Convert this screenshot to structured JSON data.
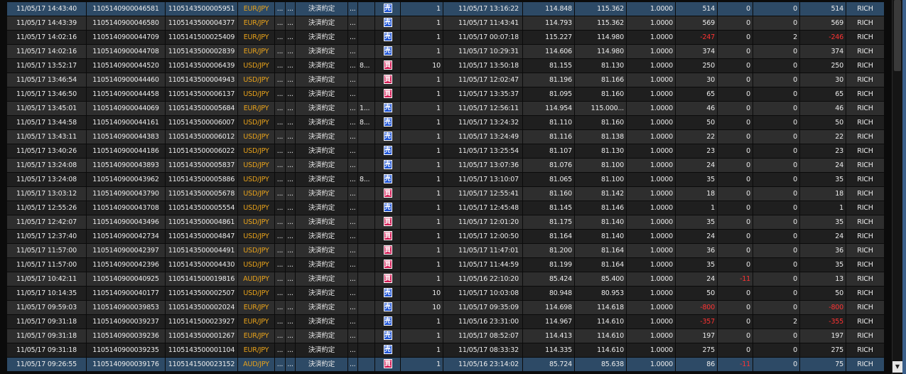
{
  "colors": {
    "background": "#0b0b0b",
    "row_dark": "#1f1f1f",
    "row_light": "#2e2e2e",
    "row_selected": "#2d4a66",
    "pair_text": "#e8a21a",
    "negative": "#ff3333",
    "sell_badge": "#1f55d6",
    "buy_badge": "#d21c55"
  },
  "icons": {
    "scroll_down": "▼"
  },
  "rows": [
    {
      "time": "11/05/17 14:43:40",
      "order_no": "1105140900046581",
      "position_no": "1105143500005951",
      "pair": "EUR/JPY",
      "d1": "...",
      "d2": "...",
      "kind": "決済約定",
      "d3": "...",
      "d4": "",
      "side": "売",
      "side_type": "sell",
      "qty": "1",
      "open_time": "11/05/17 13:16:22",
      "open_price": "114.848",
      "close_price": "115.362",
      "lot": "1.0000",
      "pl": "514",
      "swap": "0",
      "fee": "0",
      "total": "514",
      "user": "RICH",
      "pl_neg": false,
      "swap_neg": false,
      "total_neg": false,
      "selected": true
    },
    {
      "time": "11/05/17 14:43:39",
      "order_no": "1105140900046580",
      "position_no": "1105143500004377",
      "pair": "EUR/JPY",
      "d1": "...",
      "d2": "...",
      "kind": "決済約定",
      "d3": "...",
      "d4": "",
      "side": "売",
      "side_type": "sell",
      "qty": "1",
      "open_time": "11/05/17 11:43:41",
      "open_price": "114.793",
      "close_price": "115.362",
      "lot": "1.0000",
      "pl": "569",
      "swap": "0",
      "fee": "0",
      "total": "569",
      "user": "RICH",
      "pl_neg": false,
      "swap_neg": false,
      "total_neg": false,
      "selected": false
    },
    {
      "time": "11/05/17 14:02:16",
      "order_no": "1105140900044709",
      "position_no": "1105141500025409",
      "pair": "EUR/JPY",
      "d1": "...",
      "d2": "...",
      "kind": "決済約定",
      "d3": "...",
      "d4": "",
      "side": "売",
      "side_type": "sell",
      "qty": "1",
      "open_time": "11/05/17 00:07:18",
      "open_price": "115.227",
      "close_price": "114.980",
      "lot": "1.0000",
      "pl": "-247",
      "swap": "0",
      "fee": "2",
      "total": "-246",
      "user": "RICH",
      "pl_neg": true,
      "swap_neg": false,
      "total_neg": true,
      "selected": false
    },
    {
      "time": "11/05/17 14:02:16",
      "order_no": "1105140900044708",
      "position_no": "1105143500002839",
      "pair": "EUR/JPY",
      "d1": "...",
      "d2": "...",
      "kind": "決済約定",
      "d3": "...",
      "d4": "",
      "side": "売",
      "side_type": "sell",
      "qty": "1",
      "open_time": "11/05/17 10:29:31",
      "open_price": "114.606",
      "close_price": "114.980",
      "lot": "1.0000",
      "pl": "374",
      "swap": "0",
      "fee": "0",
      "total": "374",
      "user": "RICH",
      "pl_neg": false,
      "swap_neg": false,
      "total_neg": false,
      "selected": false
    },
    {
      "time": "11/05/17 13:52:17",
      "order_no": "1105140900044520",
      "position_no": "1105143500006439",
      "pair": "USD/JPY",
      "d1": "...",
      "d2": "...",
      "kind": "決済約定",
      "d3": "...",
      "d4": "8...",
      "side": "買",
      "side_type": "buy",
      "qty": "10",
      "open_time": "11/05/17 13:50:18",
      "open_price": "81.155",
      "close_price": "81.130",
      "lot": "1.0000",
      "pl": "250",
      "swap": "0",
      "fee": "0",
      "total": "250",
      "user": "RICH",
      "pl_neg": false,
      "swap_neg": false,
      "total_neg": false,
      "selected": false
    },
    {
      "time": "11/05/17 13:46:54",
      "order_no": "1105140900044460",
      "position_no": "1105143500004943",
      "pair": "USD/JPY",
      "d1": "...",
      "d2": "...",
      "kind": "決済約定",
      "d3": "...",
      "d4": "",
      "side": "買",
      "side_type": "buy",
      "qty": "1",
      "open_time": "11/05/17 12:02:47",
      "open_price": "81.196",
      "close_price": "81.166",
      "lot": "1.0000",
      "pl": "30",
      "swap": "0",
      "fee": "0",
      "total": "30",
      "user": "RICH",
      "pl_neg": false,
      "swap_neg": false,
      "total_neg": false,
      "selected": false
    },
    {
      "time": "11/05/17 13:46:50",
      "order_no": "1105140900044458",
      "position_no": "1105143500006137",
      "pair": "USD/JPY",
      "d1": "...",
      "d2": "...",
      "kind": "決済約定",
      "d3": "...",
      "d4": "",
      "side": "買",
      "side_type": "buy",
      "qty": "1",
      "open_time": "11/05/17 13:35:37",
      "open_price": "81.095",
      "close_price": "81.160",
      "lot": "1.0000",
      "pl": "65",
      "swap": "0",
      "fee": "0",
      "total": "65",
      "user": "RICH",
      "pl_neg": false,
      "swap_neg": false,
      "total_neg": false,
      "selected": false
    },
    {
      "time": "11/05/17 13:45:01",
      "order_no": "1105140900044069",
      "position_no": "1105143500005684",
      "pair": "EUR/JPY",
      "d1": "...",
      "d2": "...",
      "kind": "決済約定",
      "d3": "...",
      "d4": "1...",
      "side": "売",
      "side_type": "sell",
      "qty": "1",
      "open_time": "11/05/17 12:56:11",
      "open_price": "114.954",
      "close_price": "115.000...",
      "lot": "1.0000",
      "pl": "46",
      "swap": "0",
      "fee": "0",
      "total": "46",
      "user": "RICH",
      "pl_neg": false,
      "swap_neg": false,
      "total_neg": false,
      "selected": false
    },
    {
      "time": "11/05/17 13:44:58",
      "order_no": "1105140900044161",
      "position_no": "1105143500006007",
      "pair": "USD/JPY",
      "d1": "...",
      "d2": "...",
      "kind": "決済約定",
      "d3": "...",
      "d4": "8...",
      "side": "売",
      "side_type": "sell",
      "qty": "1",
      "open_time": "11/05/17 13:24:32",
      "open_price": "81.110",
      "close_price": "81.160",
      "lot": "1.0000",
      "pl": "50",
      "swap": "0",
      "fee": "0",
      "total": "50",
      "user": "RICH",
      "pl_neg": false,
      "swap_neg": false,
      "total_neg": false,
      "selected": false
    },
    {
      "time": "11/05/17 13:43:11",
      "order_no": "1105140900044383",
      "position_no": "1105143500006012",
      "pair": "USD/JPY",
      "d1": "...",
      "d2": "...",
      "kind": "決済約定",
      "d3": "...",
      "d4": "",
      "side": "売",
      "side_type": "sell",
      "qty": "1",
      "open_time": "11/05/17 13:24:49",
      "open_price": "81.116",
      "close_price": "81.138",
      "lot": "1.0000",
      "pl": "22",
      "swap": "0",
      "fee": "0",
      "total": "22",
      "user": "RICH",
      "pl_neg": false,
      "swap_neg": false,
      "total_neg": false,
      "selected": false
    },
    {
      "time": "11/05/17 13:40:26",
      "order_no": "1105140900044186",
      "position_no": "1105143500006022",
      "pair": "USD/JPY",
      "d1": "...",
      "d2": "...",
      "kind": "決済約定",
      "d3": "...",
      "d4": "",
      "side": "売",
      "side_type": "sell",
      "qty": "1",
      "open_time": "11/05/17 13:25:54",
      "open_price": "81.107",
      "close_price": "81.130",
      "lot": "1.0000",
      "pl": "23",
      "swap": "0",
      "fee": "0",
      "total": "23",
      "user": "RICH",
      "pl_neg": false,
      "swap_neg": false,
      "total_neg": false,
      "selected": false
    },
    {
      "time": "11/05/17 13:24:08",
      "order_no": "1105140900043893",
      "position_no": "1105143500005837",
      "pair": "USD/JPY",
      "d1": "...",
      "d2": "...",
      "kind": "決済約定",
      "d3": "...",
      "d4": "",
      "side": "売",
      "side_type": "sell",
      "qty": "1",
      "open_time": "11/05/17 13:07:36",
      "open_price": "81.076",
      "close_price": "81.100",
      "lot": "1.0000",
      "pl": "24",
      "swap": "0",
      "fee": "0",
      "total": "24",
      "user": "RICH",
      "pl_neg": false,
      "swap_neg": false,
      "total_neg": false,
      "selected": false
    },
    {
      "time": "11/05/17 13:24:08",
      "order_no": "1105140900043962",
      "position_no": "1105143500005886",
      "pair": "USD/JPY",
      "d1": "...",
      "d2": "...",
      "kind": "決済約定",
      "d3": "...",
      "d4": "8...",
      "side": "売",
      "side_type": "sell",
      "qty": "1",
      "open_time": "11/05/17 13:10:07",
      "open_price": "81.065",
      "close_price": "81.100",
      "lot": "1.0000",
      "pl": "35",
      "swap": "0",
      "fee": "0",
      "total": "35",
      "user": "RICH",
      "pl_neg": false,
      "swap_neg": false,
      "total_neg": false,
      "selected": false
    },
    {
      "time": "11/05/17 13:03:12",
      "order_no": "1105140900043790",
      "position_no": "1105143500005678",
      "pair": "USD/JPY",
      "d1": "...",
      "d2": "...",
      "kind": "決済約定",
      "d3": "...",
      "d4": "",
      "side": "買",
      "side_type": "buy",
      "qty": "1",
      "open_time": "11/05/17 12:55:41",
      "open_price": "81.160",
      "close_price": "81.142",
      "lot": "1.0000",
      "pl": "18",
      "swap": "0",
      "fee": "0",
      "total": "18",
      "user": "RICH",
      "pl_neg": false,
      "swap_neg": false,
      "total_neg": false,
      "selected": false
    },
    {
      "time": "11/05/17 12:55:26",
      "order_no": "1105140900043708",
      "position_no": "1105143500005554",
      "pair": "USD/JPY",
      "d1": "...",
      "d2": "...",
      "kind": "決済約定",
      "d3": "...",
      "d4": "",
      "side": "売",
      "side_type": "sell",
      "qty": "1",
      "open_time": "11/05/17 12:45:48",
      "open_price": "81.145",
      "close_price": "81.146",
      "lot": "1.0000",
      "pl": "1",
      "swap": "0",
      "fee": "0",
      "total": "1",
      "user": "RICH",
      "pl_neg": false,
      "swap_neg": false,
      "total_neg": false,
      "selected": false
    },
    {
      "time": "11/05/17 12:42:07",
      "order_no": "1105140900043496",
      "position_no": "1105143500004861",
      "pair": "USD/JPY",
      "d1": "...",
      "d2": "...",
      "kind": "決済約定",
      "d3": "...",
      "d4": "",
      "side": "買",
      "side_type": "buy",
      "qty": "1",
      "open_time": "11/05/17 12:01:20",
      "open_price": "81.175",
      "close_price": "81.140",
      "lot": "1.0000",
      "pl": "35",
      "swap": "0",
      "fee": "0",
      "total": "35",
      "user": "RICH",
      "pl_neg": false,
      "swap_neg": false,
      "total_neg": false,
      "selected": false
    },
    {
      "time": "11/05/17 12:37:40",
      "order_no": "1105140900042734",
      "position_no": "1105143500004847",
      "pair": "USD/JPY",
      "d1": "...",
      "d2": "...",
      "kind": "決済約定",
      "d3": "...",
      "d4": "",
      "side": "買",
      "side_type": "buy",
      "qty": "1",
      "open_time": "11/05/17 12:00:50",
      "open_price": "81.164",
      "close_price": "81.140",
      "lot": "1.0000",
      "pl": "24",
      "swap": "0",
      "fee": "0",
      "total": "24",
      "user": "RICH",
      "pl_neg": false,
      "swap_neg": false,
      "total_neg": false,
      "selected": false
    },
    {
      "time": "11/05/17 11:57:00",
      "order_no": "1105140900042397",
      "position_no": "1105143500004491",
      "pair": "USD/JPY",
      "d1": "...",
      "d2": "...",
      "kind": "決済約定",
      "d3": "...",
      "d4": "",
      "side": "買",
      "side_type": "buy",
      "qty": "1",
      "open_time": "11/05/17 11:47:01",
      "open_price": "81.200",
      "close_price": "81.164",
      "lot": "1.0000",
      "pl": "36",
      "swap": "0",
      "fee": "0",
      "total": "36",
      "user": "RICH",
      "pl_neg": false,
      "swap_neg": false,
      "total_neg": false,
      "selected": false
    },
    {
      "time": "11/05/17 11:57:00",
      "order_no": "1105140900042396",
      "position_no": "1105143500004430",
      "pair": "USD/JPY",
      "d1": "...",
      "d2": "...",
      "kind": "決済約定",
      "d3": "...",
      "d4": "",
      "side": "買",
      "side_type": "buy",
      "qty": "1",
      "open_time": "11/05/17 11:44:59",
      "open_price": "81.199",
      "close_price": "81.164",
      "lot": "1.0000",
      "pl": "35",
      "swap": "0",
      "fee": "0",
      "total": "35",
      "user": "RICH",
      "pl_neg": false,
      "swap_neg": false,
      "total_neg": false,
      "selected": false
    },
    {
      "time": "11/05/17 10:42:11",
      "order_no": "1105140900040925",
      "position_no": "1105141500019816",
      "pair": "AUD/JPY",
      "d1": "...",
      "d2": "...",
      "kind": "決済約定",
      "d3": "...",
      "d4": "",
      "side": "買",
      "side_type": "buy",
      "qty": "1",
      "open_time": "11/05/16 22:10:20",
      "open_price": "85.424",
      "close_price": "85.400",
      "lot": "1.0000",
      "pl": "24",
      "swap": "-11",
      "fee": "0",
      "total": "13",
      "user": "RICH",
      "pl_neg": false,
      "swap_neg": true,
      "total_neg": false,
      "selected": false
    },
    {
      "time": "11/05/17 10:14:35",
      "order_no": "1105140900040177",
      "position_no": "1105143500002507",
      "pair": "USD/JPY",
      "d1": "...",
      "d2": "...",
      "kind": "決済約定",
      "d3": "...",
      "d4": "",
      "side": "売",
      "side_type": "sell",
      "qty": "10",
      "open_time": "11/05/17 10:03:08",
      "open_price": "80.948",
      "close_price": "80.953",
      "lot": "1.0000",
      "pl": "50",
      "swap": "0",
      "fee": "0",
      "total": "50",
      "user": "RICH",
      "pl_neg": false,
      "swap_neg": false,
      "total_neg": false,
      "selected": false
    },
    {
      "time": "11/05/17 09:59:03",
      "order_no": "1105140900039853",
      "position_no": "1105143500002024",
      "pair": "EUR/JPY",
      "d1": "...",
      "d2": "...",
      "kind": "決済約定",
      "d3": "...",
      "d4": "",
      "side": "売",
      "side_type": "sell",
      "qty": "10",
      "open_time": "11/05/17 09:35:09",
      "open_price": "114.698",
      "close_price": "114.618",
      "lot": "1.0000",
      "pl": "-800",
      "swap": "0",
      "fee": "0",
      "total": "-800",
      "user": "RICH",
      "pl_neg": true,
      "swap_neg": false,
      "total_neg": true,
      "selected": false
    },
    {
      "time": "11/05/17 09:31:18",
      "order_no": "1105140900039237",
      "position_no": "1105141500023927",
      "pair": "EUR/JPY",
      "d1": "...",
      "d2": "...",
      "kind": "決済約定",
      "d3": "...",
      "d4": "",
      "side": "売",
      "side_type": "sell",
      "qty": "1",
      "open_time": "11/05/16 23:31:00",
      "open_price": "114.967",
      "close_price": "114.610",
      "lot": "1.0000",
      "pl": "-357",
      "swap": "0",
      "fee": "2",
      "total": "-355",
      "user": "RICH",
      "pl_neg": true,
      "swap_neg": false,
      "total_neg": true,
      "selected": false
    },
    {
      "time": "11/05/17 09:31:18",
      "order_no": "1105140900039236",
      "position_no": "1105143500001267",
      "pair": "EUR/JPY",
      "d1": "...",
      "d2": "...",
      "kind": "決済約定",
      "d3": "...",
      "d4": "",
      "side": "売",
      "side_type": "sell",
      "qty": "1",
      "open_time": "11/05/17 08:52:07",
      "open_price": "114.413",
      "close_price": "114.610",
      "lot": "1.0000",
      "pl": "197",
      "swap": "0",
      "fee": "0",
      "total": "197",
      "user": "RICH",
      "pl_neg": false,
      "swap_neg": false,
      "total_neg": false,
      "selected": false
    },
    {
      "time": "11/05/17 09:31:18",
      "order_no": "1105140900039235",
      "position_no": "1105143500001104",
      "pair": "EUR/JPY",
      "d1": "...",
      "d2": "...",
      "kind": "決済約定",
      "d3": "...",
      "d4": "",
      "side": "売",
      "side_type": "sell",
      "qty": "1",
      "open_time": "11/05/17 08:33:32",
      "open_price": "114.335",
      "close_price": "114.610",
      "lot": "1.0000",
      "pl": "275",
      "swap": "0",
      "fee": "0",
      "total": "275",
      "user": "RICH",
      "pl_neg": false,
      "swap_neg": false,
      "total_neg": false,
      "selected": false
    },
    {
      "time": "11/05/17 09:26:55",
      "order_no": "1105140900039176",
      "position_no": "1105141500023152",
      "pair": "AUD/JPY",
      "d1": "...",
      "d2": "...",
      "kind": "決済約定",
      "d3": "...",
      "d4": "",
      "side": "買",
      "side_type": "buy",
      "qty": "1",
      "open_time": "11/05/16 23:14:02",
      "open_price": "85.724",
      "close_price": "85.638",
      "lot": "1.0000",
      "pl": "86",
      "swap": "-11",
      "fee": "0",
      "total": "75",
      "user": "RICH",
      "pl_neg": false,
      "swap_neg": true,
      "total_neg": false,
      "selected": true
    }
  ]
}
